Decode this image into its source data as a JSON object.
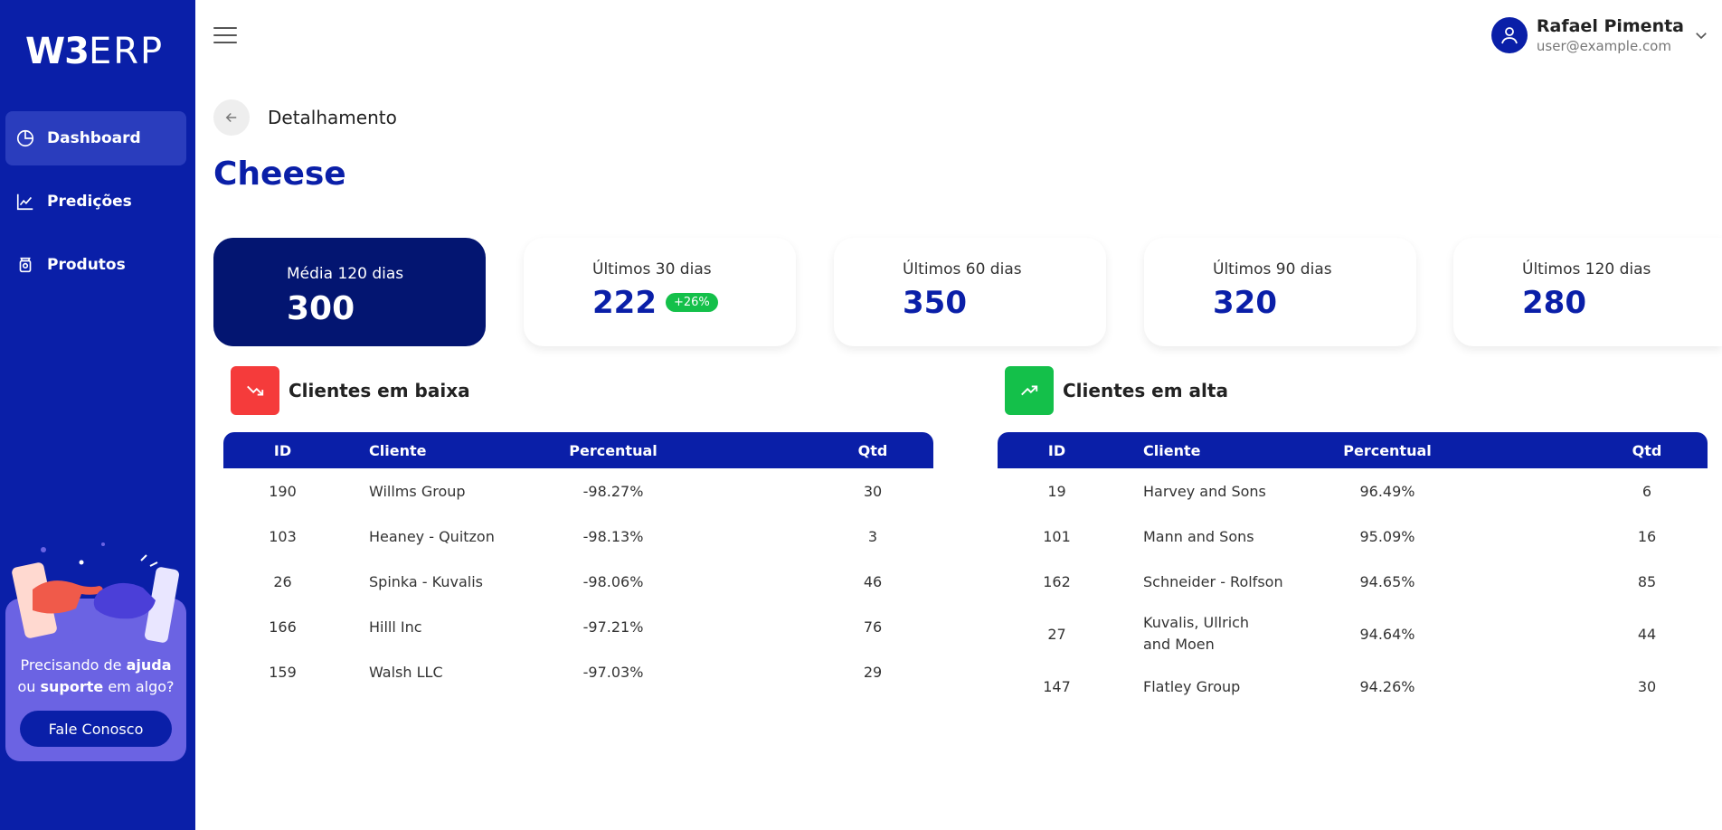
{
  "sidebar": {
    "logo_bold": "W3",
    "logo_light": "ERP",
    "items": [
      {
        "label": "Dashboard",
        "icon": "pie-chart-icon"
      },
      {
        "label": "Predições",
        "icon": "line-chart-icon"
      },
      {
        "label": "Produtos",
        "icon": "product-icon"
      }
    ],
    "help": {
      "line1_pre": "Precisando de ",
      "line1_bold": "ajuda",
      "line2_pre": "ou ",
      "line2_bold": "suporte",
      "line2_post": " em algo?",
      "button_label": "Fale Conosco"
    }
  },
  "header": {
    "user_name": "Rafael Pimenta",
    "user_email": "user@example.com"
  },
  "breadcrumb": "Detalhamento",
  "page_title": "Cheese",
  "stats": {
    "main": {
      "label": "Média 120 dias",
      "value": "300"
    },
    "cards": [
      {
        "label": "Últimos 30 dias",
        "value": "222",
        "badge": "+26%"
      },
      {
        "label": "Últimos 60 dias",
        "value": "350"
      },
      {
        "label": "Últimos 90 dias",
        "value": "320"
      },
      {
        "label": "Últimos 120 dias",
        "value": "280"
      }
    ]
  },
  "colors": {
    "primary": "#0a1fa8",
    "dark": "#031571",
    "down": "#f53b3b",
    "up": "#14c04a"
  },
  "tables": {
    "columns": [
      "ID",
      "Cliente",
      "Percentual",
      "Qtd"
    ],
    "down": {
      "title": "Clientes em baixa",
      "rows": [
        [
          "190",
          "Willms Group",
          "-98.27%",
          "30"
        ],
        [
          "103",
          "Heaney - Quitzon",
          "-98.13%",
          "3"
        ],
        [
          "26",
          "Spinka - Kuvalis",
          "-98.06%",
          "46"
        ],
        [
          "166",
          "Hilll Inc",
          "-97.21%",
          "76"
        ],
        [
          "159",
          "Walsh LLC",
          "-97.03%",
          "29"
        ]
      ]
    },
    "up": {
      "title": "Clientes em alta",
      "rows": [
        [
          "19",
          "Harvey and Sons",
          "96.49%",
          "6"
        ],
        [
          "101",
          "Mann and Sons",
          "95.09%",
          "16"
        ],
        [
          "162",
          "Schneider - Rolfson",
          "94.65%",
          "85"
        ],
        [
          "27",
          "Kuvalis, Ullrich and Moen",
          "94.64%",
          "44"
        ],
        [
          "147",
          "Flatley Group",
          "94.26%",
          "30"
        ]
      ]
    }
  }
}
